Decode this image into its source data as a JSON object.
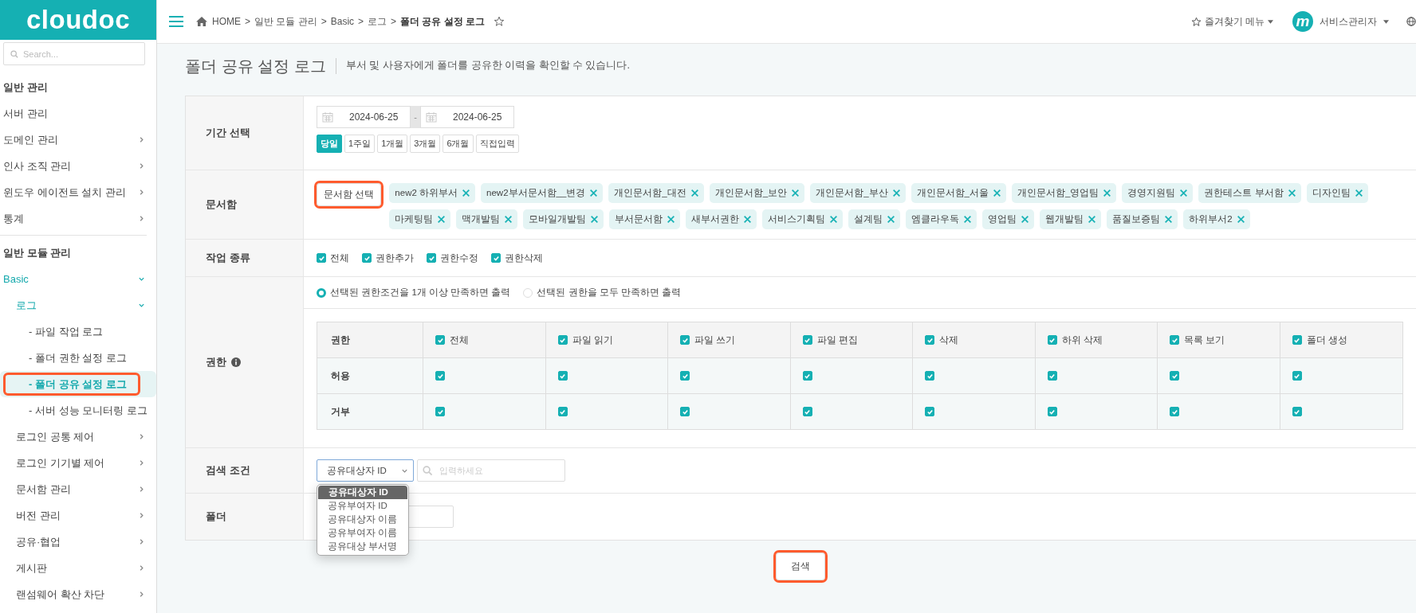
{
  "sidebar": {
    "logo": "cloudoc",
    "search": {
      "placeholder": "Search..."
    },
    "sections": [
      {
        "title": "일반 관리",
        "items": [
          {
            "label": "서버 관리",
            "selected": false
          },
          {
            "label": "도메인 관리",
            "selected": false,
            "expanded": false
          },
          {
            "label": "인사 조직 관리",
            "selected": false,
            "expanded": false
          },
          {
            "label": "윈도우 에이전트 설치 관리",
            "selected": false,
            "expanded": false
          },
          {
            "label": "통계",
            "selected": false,
            "expanded": false
          }
        ]
      },
      {
        "title": "일반 모듈 관리",
        "items": [
          {
            "label": "Basic",
            "selected": false,
            "expanded": true,
            "children": [
              {
                "label": "로그",
                "selected": false,
                "expanded": true,
                "children": [
                  {
                    "label": "- 파일 작업 로그",
                    "selected": false,
                    "highlighted": false
                  },
                  {
                    "label": "- 폴더 권한 설정 로그",
                    "selected": false,
                    "highlighted": false
                  },
                  {
                    "label": "- 폴더 공유 설정 로그",
                    "selected": true,
                    "highlighted": true
                  },
                  {
                    "label": "- 서버 성능 모니터링 로그",
                    "selected": false,
                    "highlighted": false
                  }
                ]
              },
              {
                "label": "로그인 공통 제어",
                "selected": false,
                "expanded": false
              },
              {
                "label": "로그인 기기별 제어",
                "selected": false,
                "expanded": false
              },
              {
                "label": "문서함 관리",
                "selected": false,
                "expanded": false
              },
              {
                "label": "버전 관리",
                "selected": false,
                "expanded": false
              },
              {
                "label": "공유·협업",
                "selected": false,
                "expanded": false
              },
              {
                "label": "게시판",
                "selected": false,
                "expanded": false
              },
              {
                "label": "랜섬웨어 확산 차단",
                "selected": false,
                "expanded": false
              }
            ]
          }
        ]
      }
    ]
  },
  "header": {
    "breadcrumb": [
      "HOME",
      "일반 모듈 관리",
      "Basic",
      "로그",
      "폴더 공유 설정 로그"
    ],
    "breadcrumb_separator": ">",
    "favorites_menu": "즐겨찾기 메뉴",
    "user": {
      "avatar_letter": "m",
      "name": "서비스관리자"
    }
  },
  "page": {
    "title": "폴더 공유 설정 로그",
    "description": "부서 및 사용자에게 폴더를 공유한 이력을 확인할 수 있습니다."
  },
  "form": {
    "period": {
      "label": "기간 선택",
      "start_date": "2024-06-25",
      "range_separator": "-",
      "end_date": "2024-06-25",
      "quick_ranges": [
        {
          "label": "당일",
          "selected": true
        },
        {
          "label": "1주일",
          "selected": false
        },
        {
          "label": "1개월",
          "selected": false
        },
        {
          "label": "3개월",
          "selected": false
        },
        {
          "label": "6개월",
          "selected": false
        },
        {
          "label": "직접입력",
          "selected": false
        }
      ]
    },
    "document_boxes": {
      "label": "문서함",
      "select_button": {
        "label": "문서함 선택",
        "highlighted": true
      },
      "tags": [
        "new2 하위부서",
        "new2부서문서함__변경",
        "개인문서함_대전",
        "개인문서함_보안",
        "개인문서함_부산",
        "개인문서함_서울",
        "개인문서함_영업팀",
        "경영지원팀",
        "권한테스트 부서함",
        "디자인팀",
        "마케팅팀",
        "맥개발팀",
        "모바일개발팀",
        "부서문서함",
        "새부서권한",
        "서비스기획팀",
        "설계팀",
        "엠클라우독",
        "영업팀",
        "웹개발팀",
        "품질보증팀",
        "하위부서2"
      ]
    },
    "work_types": {
      "label": "작업 종류",
      "options": [
        {
          "label": "전체",
          "checked": true
        },
        {
          "label": "권한추가",
          "checked": true
        },
        {
          "label": "권한수정",
          "checked": true
        },
        {
          "label": "권한삭제",
          "checked": true
        }
      ]
    },
    "permissions": {
      "label": "권한",
      "match_modes": [
        {
          "label": "선택된 권한조건을 1개 이상 만족하면 출력",
          "selected": true
        },
        {
          "label": "선택된 권한을 모두 만족하면 출력",
          "selected": false
        }
      ],
      "table": {
        "header": "권한",
        "columns": [
          {
            "label": "전체",
            "checked": true
          },
          {
            "label": "파일 읽기",
            "checked": true
          },
          {
            "label": "파일 쓰기",
            "checked": true
          },
          {
            "label": "파일 편집",
            "checked": true
          },
          {
            "label": "삭제",
            "checked": true
          },
          {
            "label": "하위 삭제",
            "checked": true
          },
          {
            "label": "목록 보기",
            "checked": true
          },
          {
            "label": "폴더 생성",
            "checked": true
          }
        ],
        "rows": [
          {
            "label": "허용",
            "checks": [
              true,
              true,
              true,
              true,
              true,
              true,
              true,
              true
            ]
          },
          {
            "label": "거부",
            "checks": [
              true,
              true,
              true,
              true,
              true,
              true,
              true,
              true
            ]
          }
        ]
      }
    },
    "search_condition": {
      "label": "검색 조건",
      "select": {
        "value": "공유대상자 ID",
        "expanded": true,
        "options": [
          {
            "label": "공유대상자 ID",
            "selected": true
          },
          {
            "label": "공유부여자 ID",
            "selected": false
          },
          {
            "label": "공유대상자 이름",
            "selected": false
          },
          {
            "label": "공유부여자 이름",
            "selected": false
          },
          {
            "label": "공유대상 부서명",
            "selected": false
          }
        ]
      },
      "keyword": {
        "placeholder": "입력하세요"
      }
    },
    "folder": {
      "label": "폴더"
    }
  },
  "search_button": {
    "label": "검색",
    "highlighted": true
  }
}
